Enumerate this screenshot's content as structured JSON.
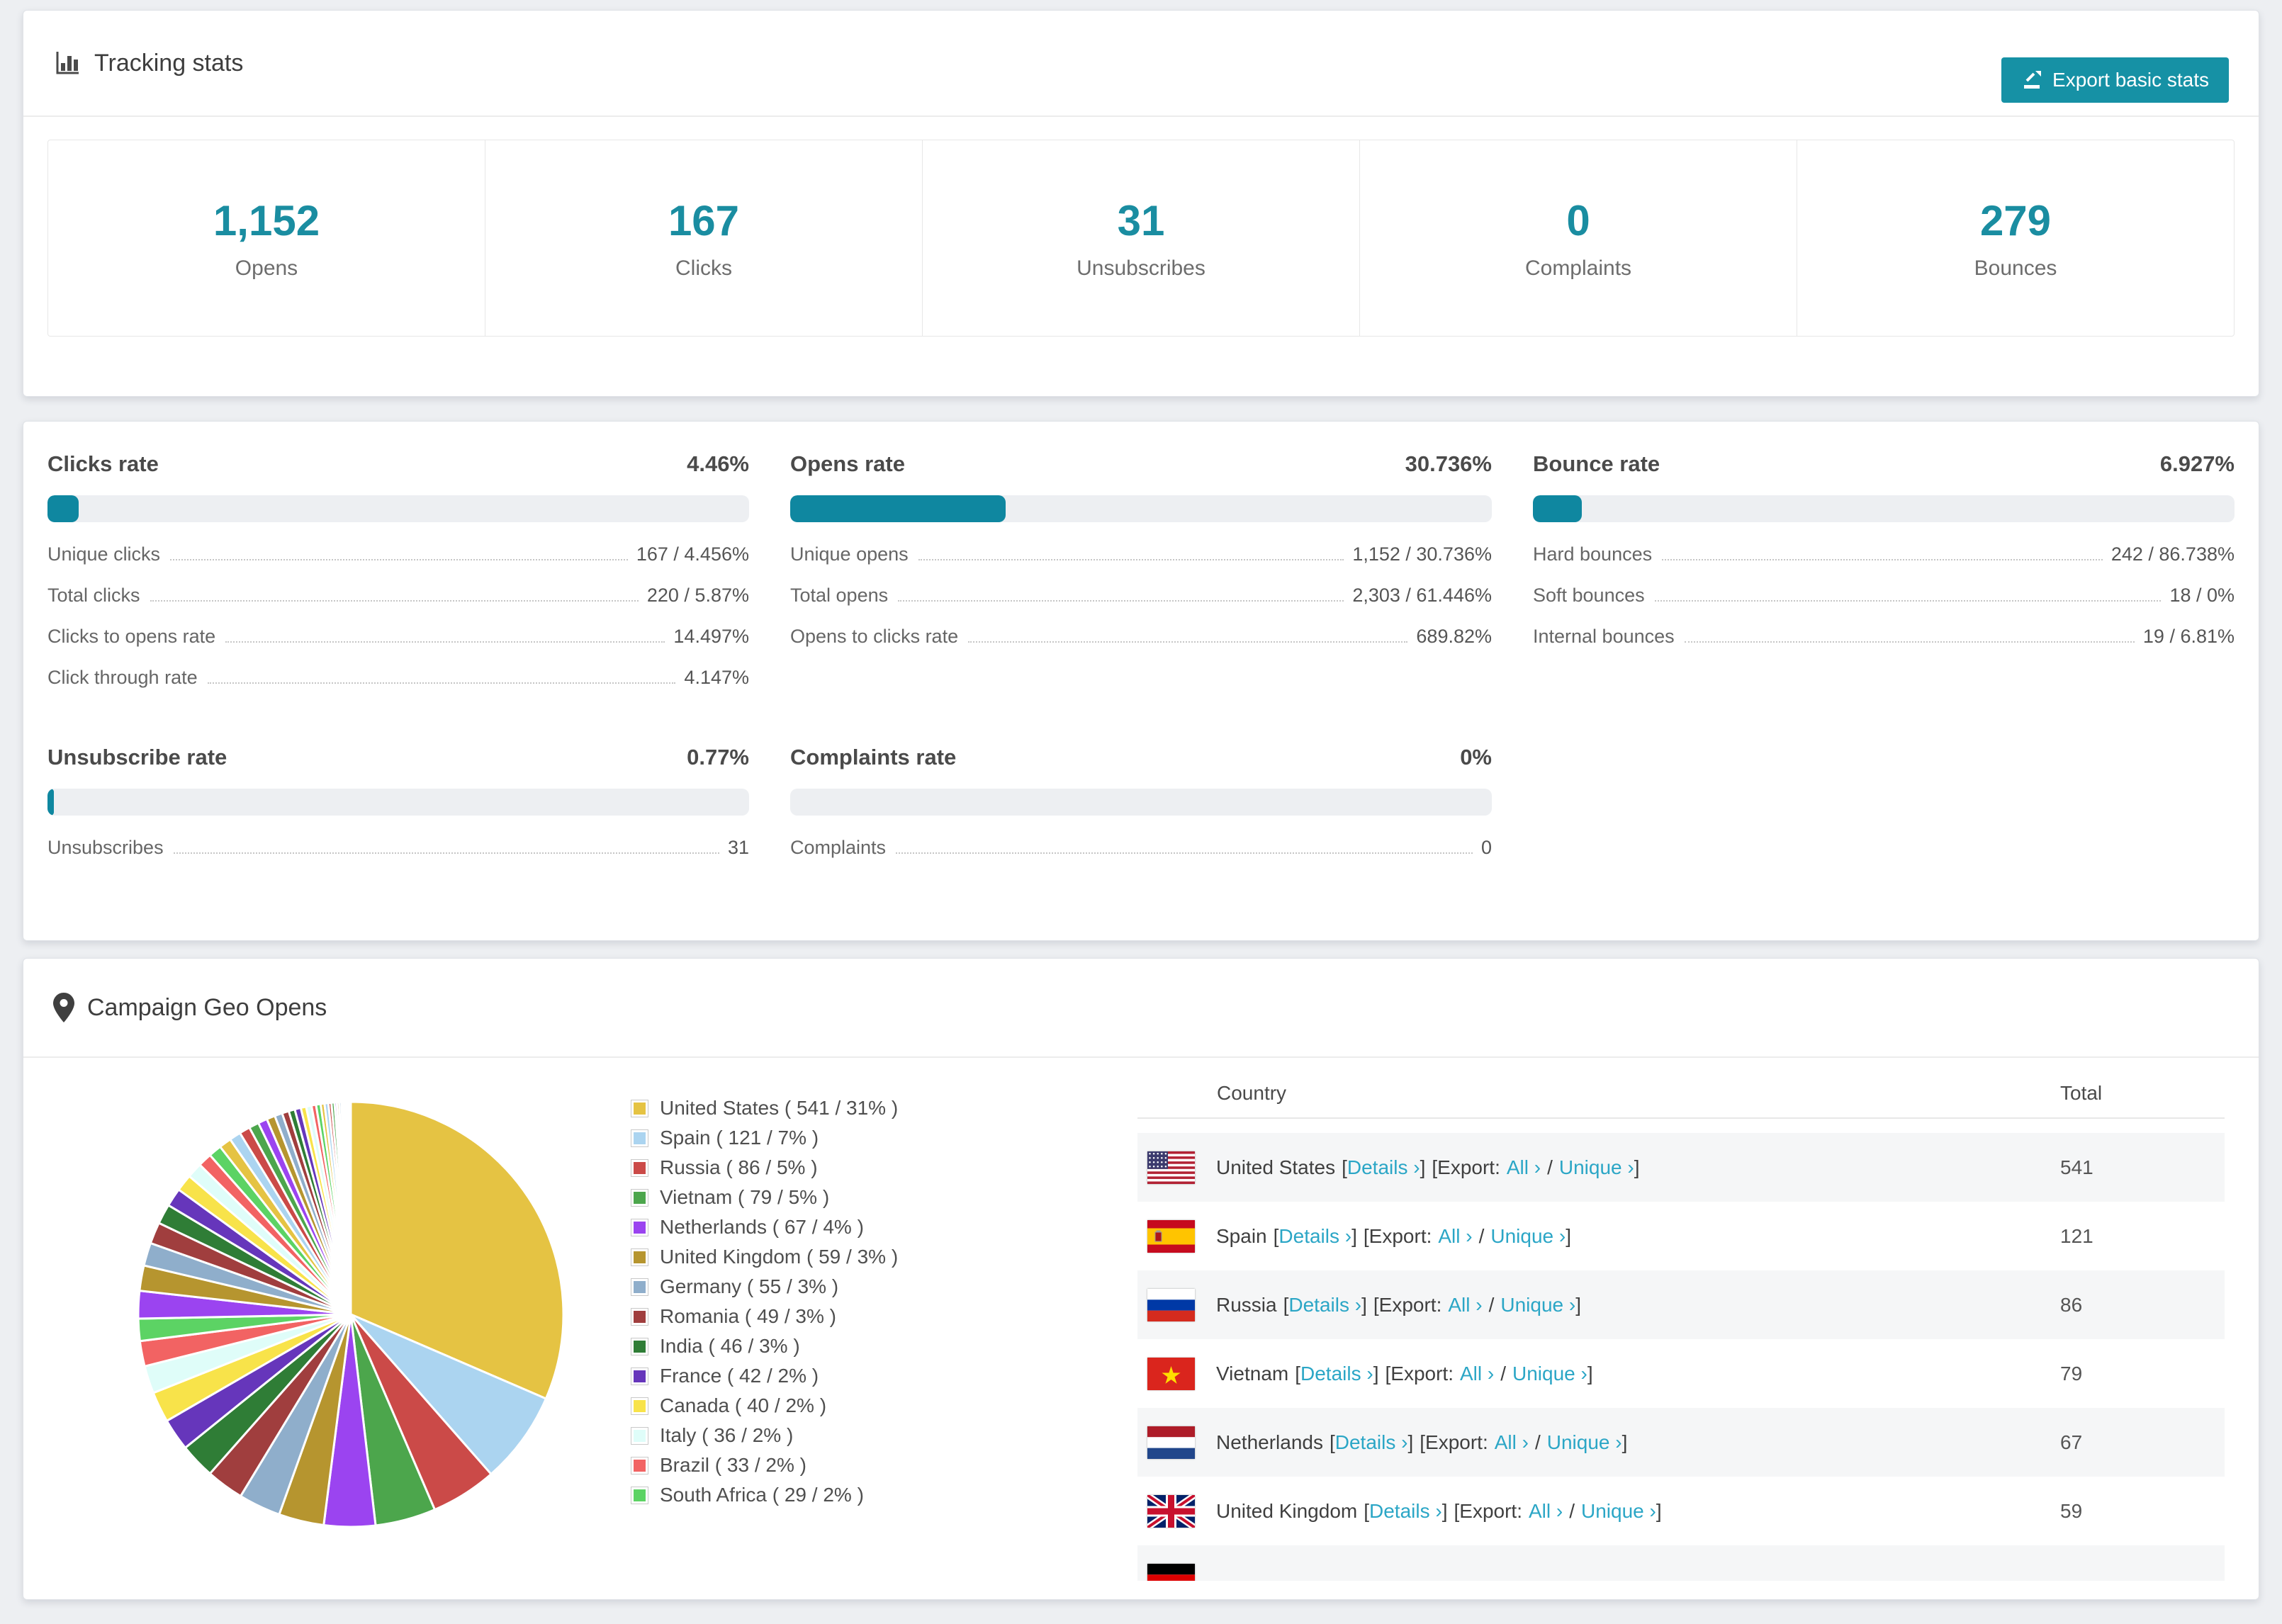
{
  "colors": {
    "accent": "#1a8da1",
    "button": "#1691a5",
    "bar_fill": "#0f87a0",
    "bar_bg": "#edeff2",
    "link": "#2ba6c6",
    "row_alt": "#f5f6f7",
    "page_bg": "#edeff2"
  },
  "tracking": {
    "title": "Tracking stats",
    "export_button": "Export basic stats",
    "icons": [
      "bar-chart-icon",
      "export-icon"
    ],
    "stats": [
      {
        "value": "1,152",
        "label": "Opens"
      },
      {
        "value": "167",
        "label": "Clicks"
      },
      {
        "value": "31",
        "label": "Unsubscribes"
      },
      {
        "value": "0",
        "label": "Complaints"
      },
      {
        "value": "279",
        "label": "Bounces"
      }
    ]
  },
  "rates": {
    "clicks": {
      "title": "Clicks rate",
      "pct": "4.46%",
      "fill_pct": 4.46,
      "rows": [
        {
          "label": "Unique clicks",
          "value": "167 / 4.456%"
        },
        {
          "label": "Total clicks",
          "value": "220 / 5.87%"
        },
        {
          "label": "Clicks to opens rate",
          "value": "14.497%"
        },
        {
          "label": "Click through rate",
          "value": "4.147%"
        }
      ]
    },
    "opens": {
      "title": "Opens rate",
      "pct": "30.736%",
      "fill_pct": 30.736,
      "rows": [
        {
          "label": "Unique opens",
          "value": "1,152 / 30.736%"
        },
        {
          "label": "Total opens",
          "value": "2,303 / 61.446%"
        },
        {
          "label": "Opens to clicks rate",
          "value": "689.82%"
        }
      ]
    },
    "bounce": {
      "title": "Bounce rate",
      "pct": "6.927%",
      "fill_pct": 6.927,
      "rows": [
        {
          "label": "Hard bounces",
          "value": "242 / 86.738%"
        },
        {
          "label": "Soft bounces",
          "value": "18 / 0%"
        },
        {
          "label": "Internal bounces",
          "value": "19 / 6.81%"
        }
      ]
    },
    "unsubscribe": {
      "title": "Unsubscribe rate",
      "pct": "0.77%",
      "fill_pct": 0.9,
      "rows": [
        {
          "label": "Unsubscribes",
          "value": "31"
        }
      ]
    },
    "complaints": {
      "title": "Complaints rate",
      "pct": "0%",
      "fill_pct": 0,
      "rows": [
        {
          "label": "Complaints",
          "value": "0"
        }
      ]
    }
  },
  "geo": {
    "title": "Campaign Geo Opens",
    "icon": "map-pin-icon",
    "legend": [
      {
        "display": "United States ( 541 / 31% )"
      },
      {
        "display": "Spain ( 121 / 7% )"
      },
      {
        "display": "Russia ( 86 / 5% )"
      },
      {
        "display": "Vietnam ( 79 / 5% )"
      },
      {
        "display": "Netherlands ( 67 / 4% )"
      },
      {
        "display": "United Kingdom ( 59 / 3% )"
      },
      {
        "display": "Germany ( 55 / 3% )"
      },
      {
        "display": "Romania ( 49 / 3% )"
      },
      {
        "display": "India ( 46 / 3% )"
      },
      {
        "display": "France ( 42 / 2% )"
      },
      {
        "display": "Canada ( 40 / 2% )"
      },
      {
        "display": "Italy ( 36 / 2% )"
      },
      {
        "display": "Brazil ( 33 / 2% )"
      },
      {
        "display": "South Africa ( 29 / 2% )"
      }
    ],
    "table": {
      "headers": {
        "country": "Country",
        "total": "Total"
      },
      "links": {
        "open_bracket": "[",
        "details": "Details ›",
        "close_bracket": "]",
        "export_prefix": "[Export:",
        "all": "All ›",
        "slash": "/",
        "unique": "Unique ›",
        "close_bracket2": "]"
      },
      "rows": [
        {
          "country": "United States",
          "flag": "us",
          "total": "541"
        },
        {
          "country": "Spain",
          "flag": "es",
          "total": "121"
        },
        {
          "country": "Russia",
          "flag": "ru",
          "total": "86"
        },
        {
          "country": "Vietnam",
          "flag": "vn",
          "total": "79"
        },
        {
          "country": "Netherlands",
          "flag": "nl",
          "total": "67"
        },
        {
          "country": "United Kingdom",
          "flag": "gb",
          "total": "59"
        }
      ],
      "partial_row": {
        "flag": "de"
      }
    }
  },
  "chart_data": {
    "type": "pie",
    "title": "Campaign Geo Opens",
    "unit": "opens",
    "legend_position": "right",
    "start_angle_deg": 0,
    "direction": "clockwise",
    "series": [
      {
        "name": "United States",
        "value": 541,
        "pct": 31
      },
      {
        "name": "Spain",
        "value": 121,
        "pct": 7
      },
      {
        "name": "Russia",
        "value": 86,
        "pct": 5
      },
      {
        "name": "Vietnam",
        "value": 79,
        "pct": 5
      },
      {
        "name": "Netherlands",
        "value": 67,
        "pct": 4
      },
      {
        "name": "United Kingdom",
        "value": 59,
        "pct": 3
      },
      {
        "name": "Germany",
        "value": 55,
        "pct": 3
      },
      {
        "name": "Romania",
        "value": 49,
        "pct": 3
      },
      {
        "name": "India",
        "value": 46,
        "pct": 3
      },
      {
        "name": "France",
        "value": 42,
        "pct": 2
      },
      {
        "name": "Canada",
        "value": 40,
        "pct": 2
      },
      {
        "name": "Italy",
        "value": 36,
        "pct": 2
      },
      {
        "name": "Brazil",
        "value": 33,
        "pct": 2
      },
      {
        "name": "South Africa",
        "value": 29,
        "pct": 2
      }
    ],
    "others_estimated_values": [
      36,
      33,
      30,
      28,
      26,
      24,
      22,
      20,
      18,
      17,
      16,
      15,
      14,
      13,
      12,
      11,
      10,
      9,
      8,
      8,
      7,
      7,
      6,
      6,
      5,
      5,
      4,
      4,
      3,
      3,
      3,
      2,
      2,
      2,
      1,
      1,
      1,
      1,
      1,
      1
    ],
    "palette": [
      "#E5C343",
      "#ABD4F0",
      "#CB4A48",
      "#4CA64C",
      "#9B44F0",
      "#B6952F",
      "#8FAECB",
      "#A03E3E",
      "#2F7D36",
      "#6636BB",
      "#F8E34A",
      "#DFFDF9",
      "#F26363",
      "#5CD364"
    ]
  }
}
